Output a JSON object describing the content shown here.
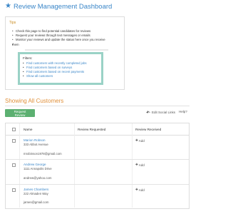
{
  "header": {
    "title": "Review Management Dashboard",
    "icon": "star-icon",
    "accent_color": "#3a86c8"
  },
  "tips": {
    "title": "Tips",
    "items": [
      "Check this page to find potential candidates for reviews",
      "Request your reviews through text messages or emails",
      "Monitor your reviews and update the status here once you receive",
      "them"
    ]
  },
  "filters": {
    "label": "Filters:",
    "items": [
      "Find customers with recently completed jobs",
      "Find customers based on surveys",
      "Find customers based on recent payments",
      "Show all customers"
    ]
  },
  "section": {
    "title": "Showing All Customers"
  },
  "toolbar": {
    "request_review": "Request Review",
    "edit_social_links": "Edit Social Links",
    "help": "Help?"
  },
  "table": {
    "headers": {
      "name": "Name",
      "review_requested": "Review Requested",
      "review_received": "Review Received"
    },
    "rows": [
      {
        "name": "Marion Robson",
        "address": "333 Abbot Avenue",
        "email": "mrobinson1978@gmail.com",
        "received": "Add"
      },
      {
        "name": "Andrew George",
        "address": "1111 Annapolis Drive",
        "email": "andrew@yahoo.com",
        "received": "Add"
      },
      {
        "name": "James Chambers",
        "address": "222 Almaden Way",
        "email": "james@gmail.com",
        "received": "Add"
      }
    ]
  }
}
